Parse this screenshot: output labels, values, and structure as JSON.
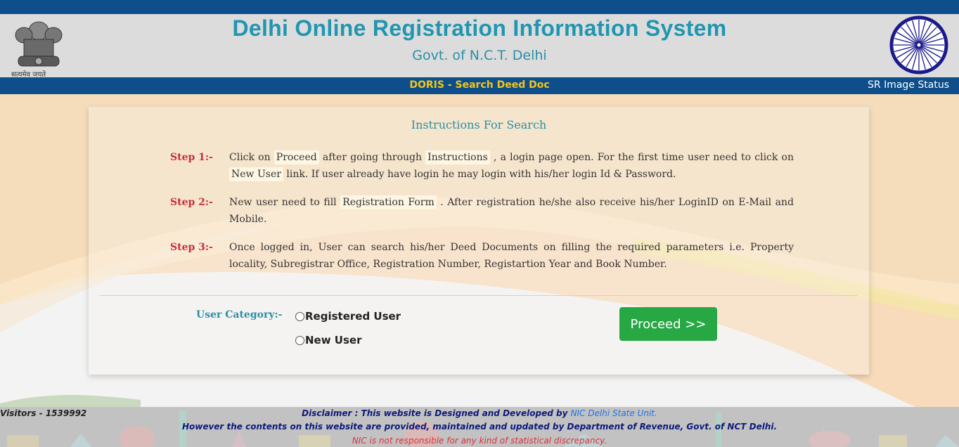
{
  "header": {
    "emblem_icon": "ashoka-emblem-icon",
    "emblem_caption": "सत्यमेव जयते",
    "title": "Delhi Online Registration Information System",
    "subtitle": "Govt. of N.C.T. Delhi",
    "chakra_icon": "ashoka-chakra-icon"
  },
  "nav": {
    "page_title": "DORIS - Search Deed Doc",
    "sr_image_status": "SR Image Status"
  },
  "instructions": {
    "title": "Instructions For Search",
    "steps": [
      {
        "label": "Step 1:-",
        "parts": [
          "Click on ",
          "Proceed",
          " after going through ",
          "Instructions",
          " , a login page open. For the first time user need to click on ",
          "New User",
          " link. If user already have login he may login with his/her login Id & Password."
        ]
      },
      {
        "label": "Step 2:-",
        "parts": [
          "New user need to fill ",
          "Registration Form",
          " . After registration he/she also receive his/her LoginID on E-Mail and Mobile."
        ]
      },
      {
        "label": "Step 3:-",
        "text": "Once logged in, User can search his/her Deed Documents on filling the required parameters i.e. Property locality, Subregistrar Office, Registration Number, Registartion Year and Book Number."
      }
    ]
  },
  "form": {
    "category_label": "User Category:-",
    "options": [
      {
        "label": "Registered User",
        "checked": false
      },
      {
        "label": "New User",
        "checked": false
      }
    ],
    "proceed_label": "Proceed >>"
  },
  "footer": {
    "visitors": "Visitors - 1539992",
    "disclaimer_prefix": "Disclaimer : This website is Designed and Developed by ",
    "disclaimer_link": "NIC Delhi State Unit.",
    "disclaimer_line2": "However the contents on this website are provided, maintained and updated by Department of Revenue, Govt. of NCT Delhi.",
    "disclaimer_line3": "NIC is not responsible for any kind of statistical discrepancy."
  },
  "colors": {
    "header_blue": "#0e4f8b",
    "title_teal": "#2196b0",
    "nav_yellow": "#f5c518",
    "step_red": "#c62f3a",
    "proceed_green": "#28a745",
    "disclaimer_navy": "#0d1a7a",
    "disclaimer_red": "#d9303b"
  }
}
